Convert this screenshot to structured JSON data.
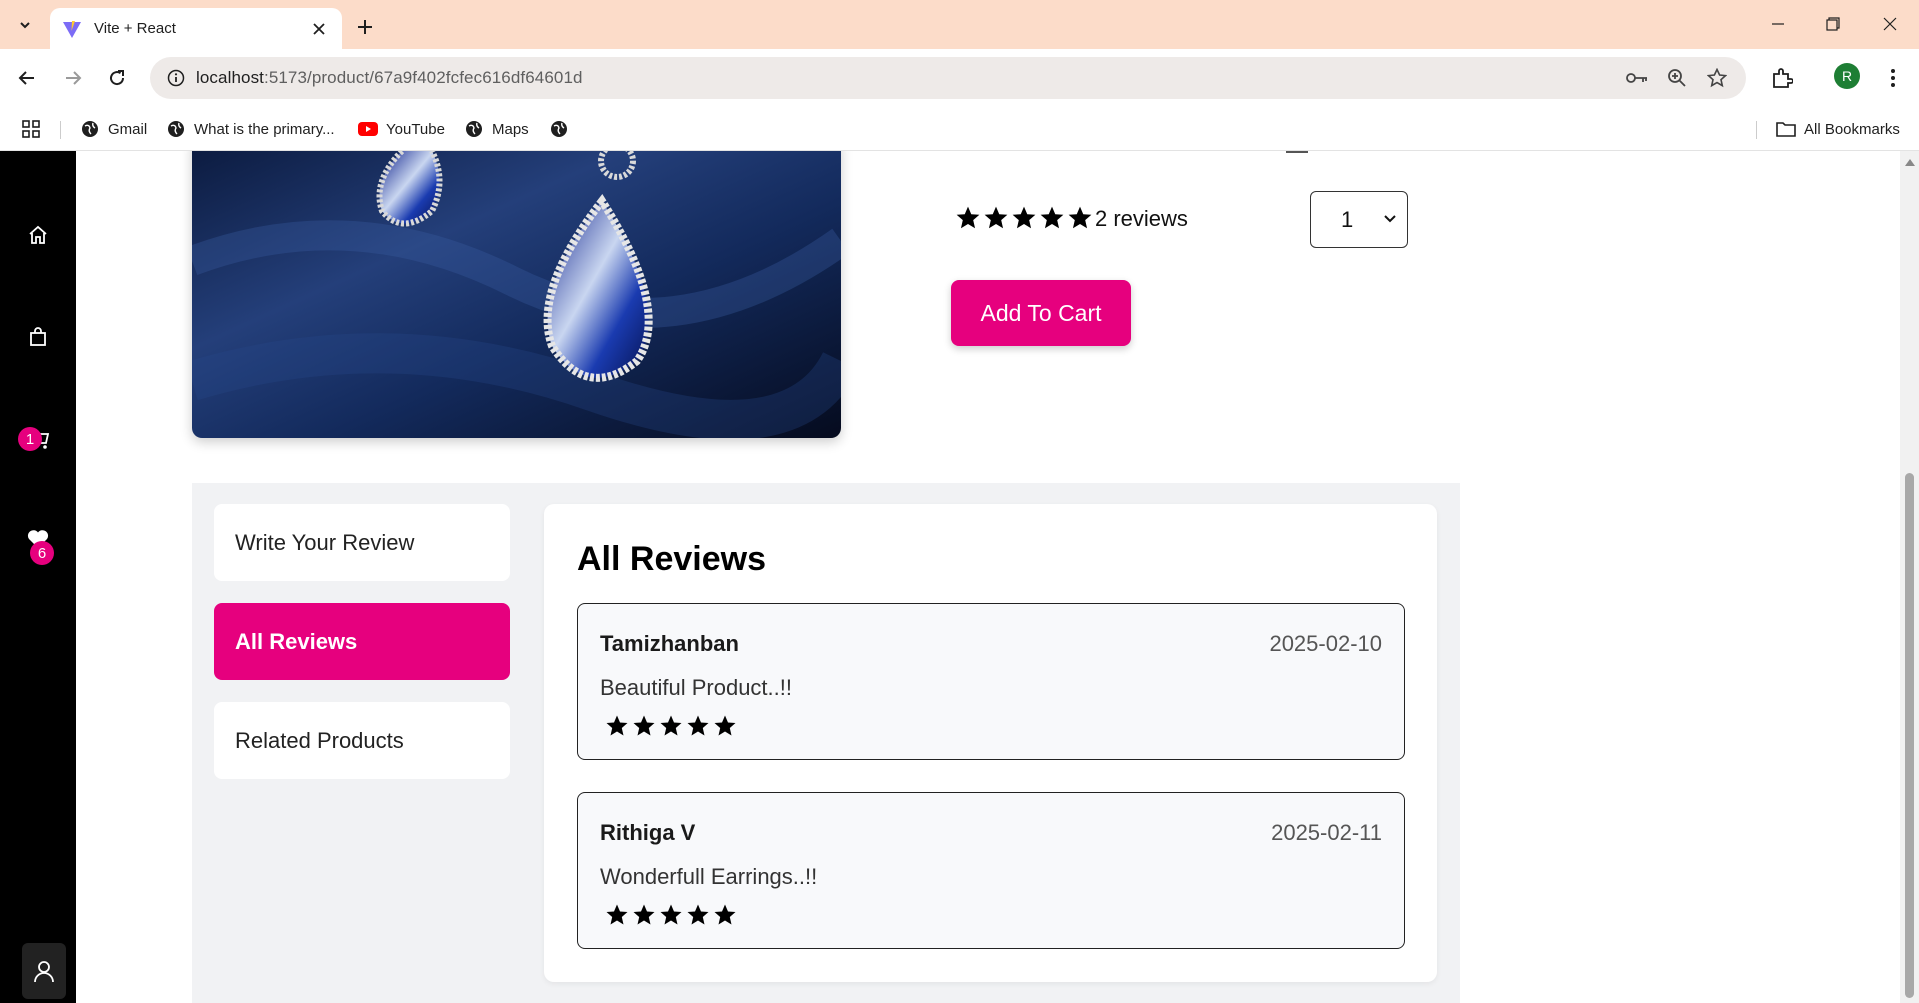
{
  "browser": {
    "tab_title": "Vite + React",
    "url_host": "localhost",
    "url_path": ":5173/product/67a9f402fcfec616df64601d",
    "profile_initial": "R",
    "bookmarks": [
      {
        "label": "Gmail",
        "icon": "globe-icon"
      },
      {
        "label": "What is the primary...",
        "icon": "globe-icon"
      },
      {
        "label": "YouTube",
        "icon": "youtube-icon"
      },
      {
        "label": "Maps",
        "icon": "globe-icon"
      },
      {
        "label": "",
        "icon": "globe-icon"
      }
    ],
    "all_bookmarks_label": "All Bookmarks"
  },
  "sidebar": {
    "cart_count": "1",
    "wishlist_count": "6",
    "icons": [
      "home-icon",
      "shopping-bag-icon",
      "cart-icon",
      "heart-icon",
      "user-icon"
    ]
  },
  "product": {
    "rating_stars": 5,
    "reviews_count": "2 reviews",
    "quantity": "1",
    "add_to_cart_label": "Add To Cart"
  },
  "tabs": {
    "items": [
      {
        "label": "Write Your Review",
        "active": false
      },
      {
        "label": "All Reviews",
        "active": true
      },
      {
        "label": "Related Products",
        "active": false
      }
    ]
  },
  "reviews": {
    "title": "All Reviews",
    "items": [
      {
        "author": "Tamizhanban",
        "date": "2025-02-10",
        "text": "Beautiful Product..!!",
        "stars": 5
      },
      {
        "author": "Rithiga V",
        "date": "2025-02-11",
        "text": "Wonderfull Earrings..!!",
        "stars": 5
      }
    ]
  },
  "colors": {
    "accent": "#e6007e",
    "sidebar_bg": "#000000",
    "tabbar_bg": "#fcdcc9"
  }
}
